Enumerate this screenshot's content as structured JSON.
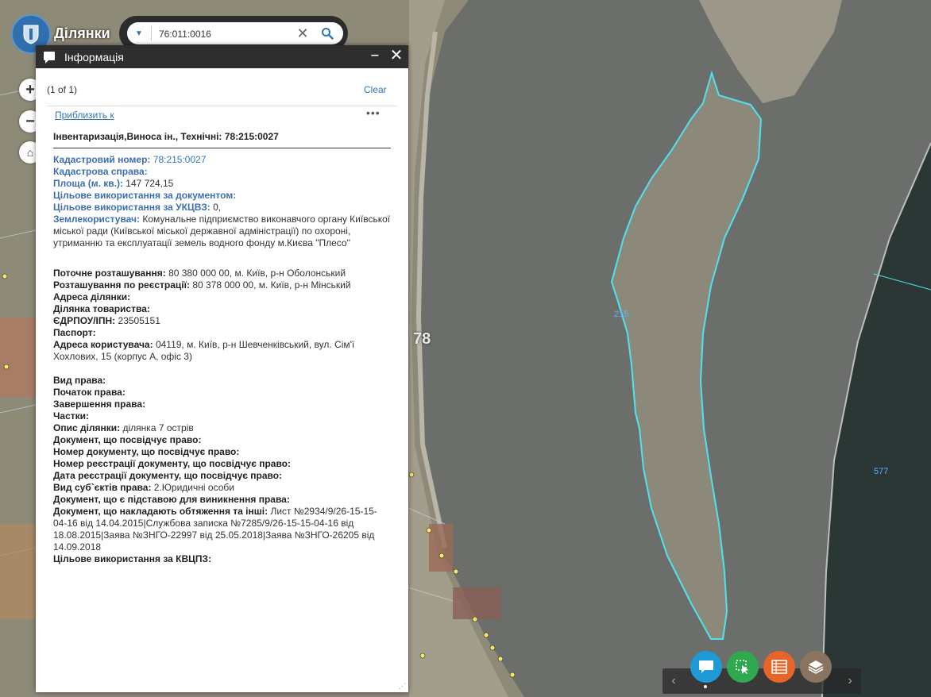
{
  "app": {
    "title": "Ділянки"
  },
  "search": {
    "value": "76:011:0016"
  },
  "map": {
    "labels": {
      "block": "78",
      "island_parcel": "215",
      "east_parcel": "577"
    }
  },
  "panel": {
    "title": "Інформація",
    "pager": "(1 of 1)",
    "clear_label": "Clear",
    "zoom_label": "Приблизить к",
    "record_title": "Інвентаризація,Виноса ін., Технічні: 78:215:0027",
    "fields": {
      "cadastral_number": {
        "label": "Кадастровий номер:",
        "value": "78:215:0027"
      },
      "cadastral_case": {
        "label": "Кадастрова справа:"
      },
      "area": {
        "label": "Площа (м. кв.):",
        "value": "147 724,15"
      },
      "use_by_doc": {
        "label": "Цільове використання за документом:"
      },
      "use_ukcvz": {
        "label": "Цільове використання за УКЦВЗ:",
        "value": "0,"
      },
      "land_user": {
        "label": "Землекористувач:",
        "value": "Комунальне підприємство виконавчого органу Київської міської ради (Київської міської державної адміністрації) по охороні, утриманню та експлуатації земель водного фонду м.Києва \"Плесо\""
      },
      "current_location": {
        "label": "Поточне розташування:",
        "value": "80 380 000 00, м. Київ, р-н Оболонський"
      },
      "registered_location": {
        "label": "Розташування по реєстрації:",
        "value": "80 378 000 00, м. Київ, р-н Мінський"
      },
      "parcel_address": {
        "label": "Адреса ділянки:"
      },
      "partnership_parcel": {
        "label": "Ділянка товариства:"
      },
      "edrpou": {
        "label": "ЄДРПОУ/ІПН:",
        "value": "23505151"
      },
      "passport": {
        "label": "Паспорт:"
      },
      "user_address": {
        "label": "Адреса користувача:",
        "value": "04119, м. Київ, р-н Шевченківський, вул. Сім'ї Хохлових, 15 (корпус А, офіс 3)"
      },
      "right_type": {
        "label": "Вид права:"
      },
      "right_start": {
        "label": "Початок права:"
      },
      "right_end": {
        "label": "Завершення права:"
      },
      "shares": {
        "label": "Частки:"
      },
      "parcel_desc": {
        "label": "Опис ділянки:",
        "value": "ділянка 7 острів"
      },
      "right_doc": {
        "label": "Документ, що посвідчує право:"
      },
      "right_doc_num": {
        "label": "Номер документу, що посвідчує право:"
      },
      "right_doc_reg_num": {
        "label": "Номер реєстрації документу, що посвідчує право:"
      },
      "right_doc_reg_date": {
        "label": "Дата реєстрації документу, що посвідчує право:"
      },
      "subject_type": {
        "label": "Вид суб`єктів права:",
        "value": "2.Юридичні особи"
      },
      "basis_doc": {
        "label": "Документ, що є підставою для виникнення права:"
      },
      "encumbrance_doc": {
        "label": "Документ, що накладають обтяження та інші:",
        "value": "Лист №2934/9/26-15-15-04-16 від 14.04.2015|Службова записка №7285/9/26-15-15-04-16 від 18.08.2015|Заява №ЗНГО-22997 від 25.05.2018|Заява №ЗНГО-26205 від 14.09.2018"
      },
      "use_kvcpz": {
        "label": "Цільове використання за КВЦПЗ:"
      }
    }
  },
  "colors": {
    "water": "#6b6d6b",
    "parcel_outline": "#4fe3f0",
    "island": "#8d8a7c",
    "accent": "#2f78b4",
    "toolbar_info": "#1e9ad6",
    "toolbar_select": "#2fa84f",
    "toolbar_table": "#e8652a",
    "toolbar_layers": "#8a7460"
  },
  "toolbar": {
    "icons": [
      "info-bubble-icon",
      "select-icon",
      "table-icon",
      "layers-icon"
    ]
  }
}
